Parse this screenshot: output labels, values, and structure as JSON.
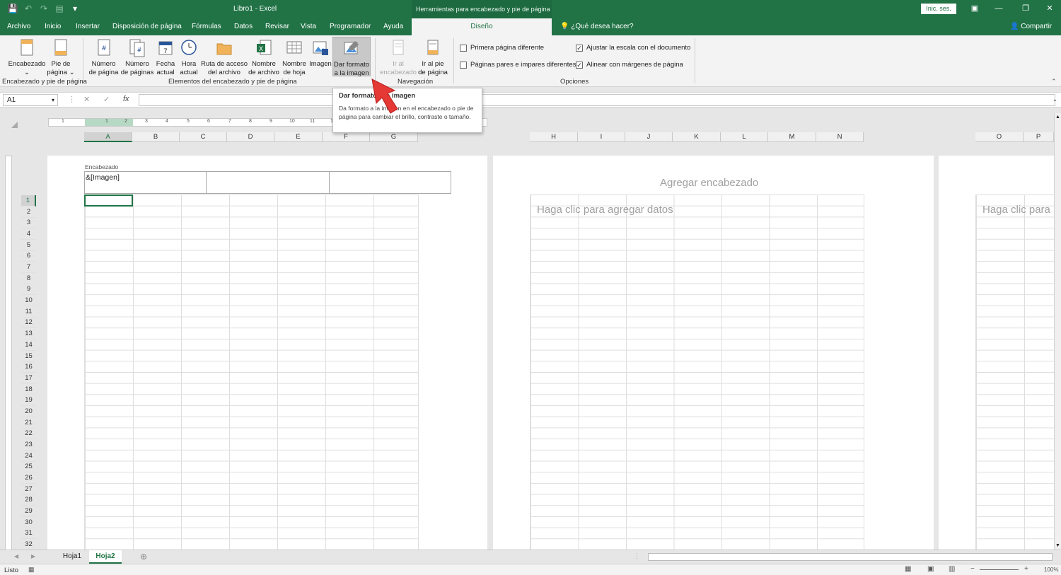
{
  "titlebar": {
    "title": "Libro1  -  Excel",
    "context_title": "Herramientas para encabezado y pie de página",
    "signin": "Inic. ses."
  },
  "tabs": [
    "Archivo",
    "Inicio",
    "Insertar",
    "Disposición de página",
    "Fórmulas",
    "Datos",
    "Revisar",
    "Vista",
    "Programador",
    "Ayuda"
  ],
  "active_tab": "Diseño",
  "tellme": "¿Qué desea hacer?",
  "share": "Compartir",
  "ribbon": {
    "encabezado": [
      "Encabezado",
      "⌄"
    ],
    "pie": [
      "Pie de",
      "página ⌄"
    ],
    "numero_pagina": [
      "Número",
      "de página"
    ],
    "numero_paginas": [
      "Número",
      "de páginas"
    ],
    "fecha": [
      "Fecha",
      "actual"
    ],
    "hora": [
      "Hora",
      "actual"
    ],
    "ruta": [
      "Ruta de acceso",
      "del archivo"
    ],
    "nombre_archivo": [
      "Nombre",
      "de archivo"
    ],
    "nombre_hoja": [
      "Nombre",
      "de hoja"
    ],
    "imagen": "Imagen",
    "dar_formato": [
      "Dar formato",
      "a la imagen"
    ],
    "ir_encabezado": [
      "Ir al",
      "encabezado"
    ],
    "ir_pie": [
      "Ir al pie",
      "de página"
    ],
    "groups": {
      "g1": "Encabezado y pie de página",
      "g2": "Elementos del encabezado y pie de página",
      "g3": "Navegación",
      "g4": "Opciones"
    },
    "options": {
      "primera": "Primera página diferente",
      "pares": "Páginas pares e impares diferentes",
      "ajustar": "Ajustar la escala con el documento",
      "alinear": "Alinear con márgenes de página"
    }
  },
  "formula_bar": {
    "namebox": "A1",
    "cancel": "✕",
    "enter": "✓",
    "fx": "fx"
  },
  "tooltip": {
    "title": "Dar formato a la imagen",
    "body": "Da formato a la imagen en el encabezado o pie de página para cambiar el brillo, contraste o tamaño."
  },
  "columns_p1": [
    "A",
    "B",
    "C",
    "D",
    "E",
    "F",
    "G"
  ],
  "columns_p2": [
    "H",
    "I",
    "J",
    "K",
    "L",
    "M",
    "N"
  ],
  "columns_p3": [
    "O",
    "P"
  ],
  "ruler": [
    "1",
    "1",
    "2",
    "3",
    "4",
    "5",
    "6",
    "7",
    "8",
    "9",
    "10",
    "11",
    "12",
    "13"
  ],
  "rows": [
    "1",
    "2",
    "3",
    "4",
    "5",
    "6",
    "7",
    "8",
    "9",
    "10",
    "11",
    "12",
    "13",
    "14",
    "15",
    "16",
    "17",
    "18",
    "19",
    "20",
    "21",
    "22",
    "23",
    "24",
    "25",
    "26",
    "27",
    "28",
    "29",
    "30",
    "31",
    "32"
  ],
  "page": {
    "header_label": "Encabezado",
    "header_text": "&[Imagen]",
    "add_header": "Agregar encabezado",
    "add_data": "Haga clic para agregar datos",
    "add_data_cut": "Haga clic para"
  },
  "sheets": [
    "Hoja1",
    "Hoja2"
  ],
  "active_sheet": "Hoja2",
  "status": {
    "text": "Listo",
    "zoom": "100%"
  },
  "colors": {
    "accent": "#217346",
    "arrow": "#e53935"
  }
}
